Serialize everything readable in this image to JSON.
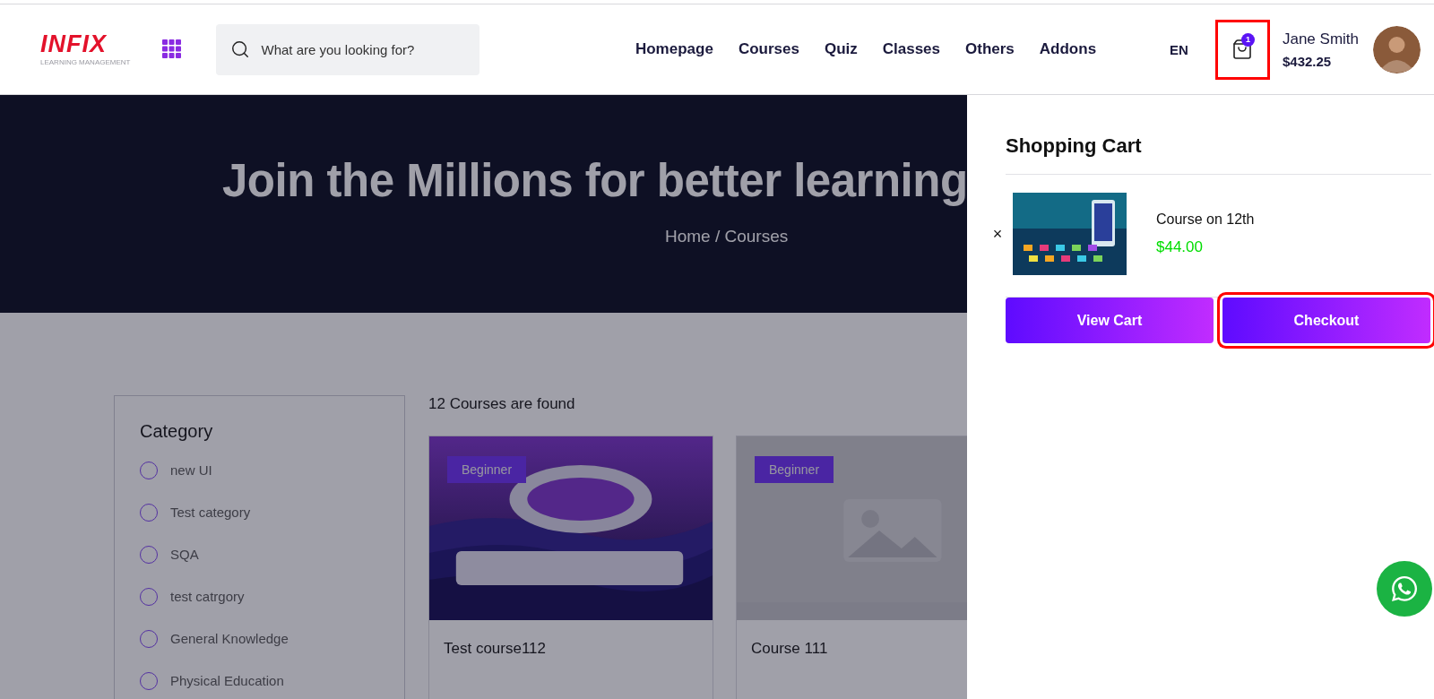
{
  "header": {
    "logo": {
      "wordmark": "INFIX",
      "tagline": "LEARNING MANAGEMENT"
    },
    "search": {
      "placeholder": "What are you looking for?"
    },
    "nav": [
      "Homepage",
      "Courses",
      "Quiz",
      "Classes",
      "Others",
      "Addons"
    ],
    "language": "EN",
    "cart": {
      "count": "1",
      "highlighted": true
    },
    "user": {
      "name": "Jane Smith",
      "balance": "$432.25"
    }
  },
  "hero": {
    "title": "Join the Millions for better learning",
    "breadcrumb": "Home / Courses"
  },
  "filters": {
    "title": "Category",
    "options": [
      {
        "label": "new UI",
        "checked": false
      },
      {
        "label": "Test category",
        "checked": false
      },
      {
        "label": "SQA",
        "checked": false
      },
      {
        "label": "test catrgory",
        "checked": false
      },
      {
        "label": "General Knowledge",
        "checked": false
      },
      {
        "label": "Physical Education",
        "checked": false
      }
    ]
  },
  "results": {
    "count_text": "12 Courses are found",
    "courses": [
      {
        "level": "Beginner",
        "title": "Test course112"
      },
      {
        "level": "Beginner",
        "title": "Course 111"
      }
    ]
  },
  "overlay": {
    "visible": true
  },
  "cart_drawer": {
    "title": "Shopping Cart",
    "items": [
      {
        "remove": "×",
        "name": "Course on 12th",
        "price": "$44.00"
      }
    ],
    "buttons": [
      {
        "label": "View Cart",
        "highlighted": false
      },
      {
        "label": "Checkout",
        "highlighted": true
      }
    ]
  }
}
